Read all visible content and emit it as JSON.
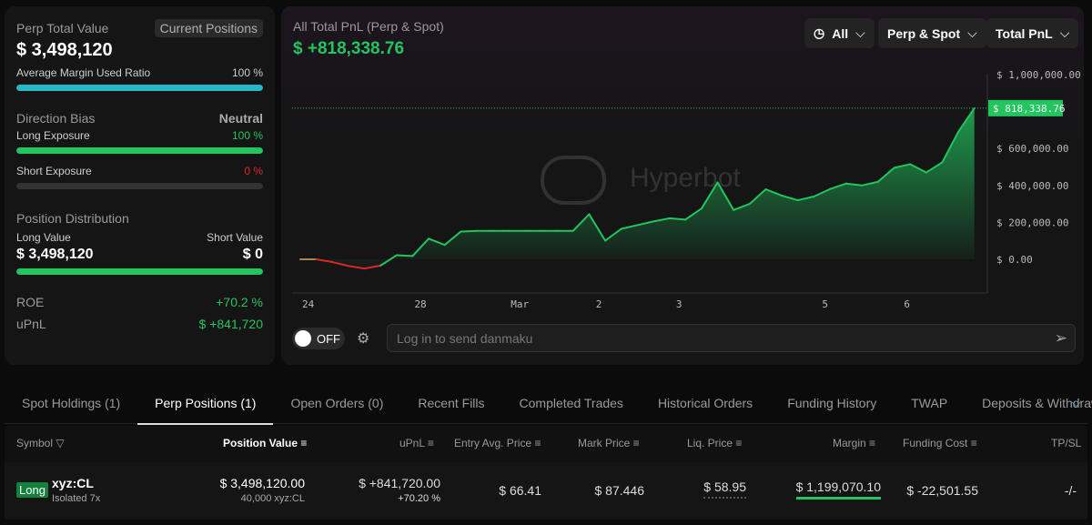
{
  "summary": {
    "perp_total_label": "Perp Total Value",
    "current_positions": "Current Positions",
    "perp_total_value": "$ 3,498,120",
    "margin_label": "Average Margin Used Ratio",
    "margin_value": "100 %",
    "margin_ratio": 1.0,
    "direction_label": "Direction Bias",
    "direction_value": "Neutral",
    "long_exposure_label": "Long Exposure",
    "long_exposure_value": "100 %",
    "long_ratio": 1.0,
    "short_exposure_label": "Short Exposure",
    "short_exposure_value": "0 %",
    "short_ratio": 0,
    "distribution_label": "Position Distribution",
    "long_value_label": "Long Value",
    "short_value_label": "Short Value",
    "long_value": "$ 3,498,120",
    "short_value": "$ 0",
    "roe_label": "ROE",
    "roe_value": "+70.2 %",
    "upnl_label": "uPnL",
    "upnl_value": "$ +841,720"
  },
  "chart_header": {
    "title": "All Total PnL (Perp & Spot)",
    "value": "$ +818,338.76",
    "range": "All",
    "scope": "Perp & Spot",
    "metric": "Total PnL",
    "watermark": "Hyperbot"
  },
  "danmaku": {
    "toggle": "OFF",
    "placeholder": "Log in to send danmaku"
  },
  "chart_data": {
    "type": "area",
    "title": "All Total PnL (Perp & Spot)",
    "ylim": [
      -200000,
      1050000
    ],
    "y_ticks": [
      {
        "v": 1000000,
        "label": "$ 1,000,000.00"
      },
      {
        "v": 600000,
        "label": "$ 600,000.00"
      },
      {
        "v": 400000,
        "label": "$ 400,000.00"
      },
      {
        "v": 200000,
        "label": "$ 200,000.00"
      },
      {
        "v": 0,
        "label": "$ 0.00"
      }
    ],
    "current_label": "$ 818,338.76",
    "current": 818338.76,
    "x_ticks": [
      {
        "i": 0,
        "label": "24"
      },
      {
        "i": 7,
        "label": "28"
      },
      {
        "i": 13,
        "label": "Mar"
      },
      {
        "i": 18.3,
        "label": "2"
      },
      {
        "i": 23.3,
        "label": "3"
      },
      {
        "i": 32.4,
        "label": "5"
      },
      {
        "i": 37.5,
        "label": "6"
      }
    ],
    "values": [
      0,
      0,
      -15000,
      -36000,
      -50000,
      -34000,
      22000,
      18000,
      112000,
      78000,
      150000,
      154000,
      154000,
      154000,
      154000,
      154000,
      154000,
      154000,
      244000,
      101000,
      165000,
      185000,
      205000,
      222000,
      215000,
      275000,
      416000,
      267000,
      300000,
      379000,
      345000,
      320000,
      340000,
      380000,
      410000,
      400000,
      420000,
      495000,
      515000,
      470000,
      525000,
      690000,
      818338.76
    ]
  },
  "tabs": [
    "Spot Holdings (1)",
    "Perp Positions (1)",
    "Open Orders (0)",
    "Recent Fills",
    "Completed Trades",
    "Historical Orders",
    "Funding History",
    "TWAP",
    "Deposits & Withdraw"
  ],
  "table": {
    "headers": {
      "symbol": "Symbol",
      "position_value": "Position Value",
      "upnl": "uPnL",
      "entry": "Entry Avg. Price",
      "mark": "Mark Price",
      "liq": "Liq. Price",
      "margin": "Margin",
      "funding": "Funding Cost",
      "tpsl": "TP/SL"
    },
    "row": {
      "side": "Long",
      "symbol": "xyz:CL",
      "mode": "Isolated 7x",
      "position_value": "$ 3,498,120.00",
      "size": "40,000 xyz:CL",
      "upnl": "$ +841,720.00",
      "upnl_pct": "+70.20 %",
      "entry": "$ 66.41",
      "mark": "$ 87.446",
      "liq": "$ 58.95",
      "margin": "$ 1,199,070.10",
      "funding": "$ -22,501.55",
      "tpsl": "-/-"
    }
  },
  "colors": {
    "green": "#22c55e",
    "red": "#dc2626",
    "cyan": "#26b8c9"
  }
}
